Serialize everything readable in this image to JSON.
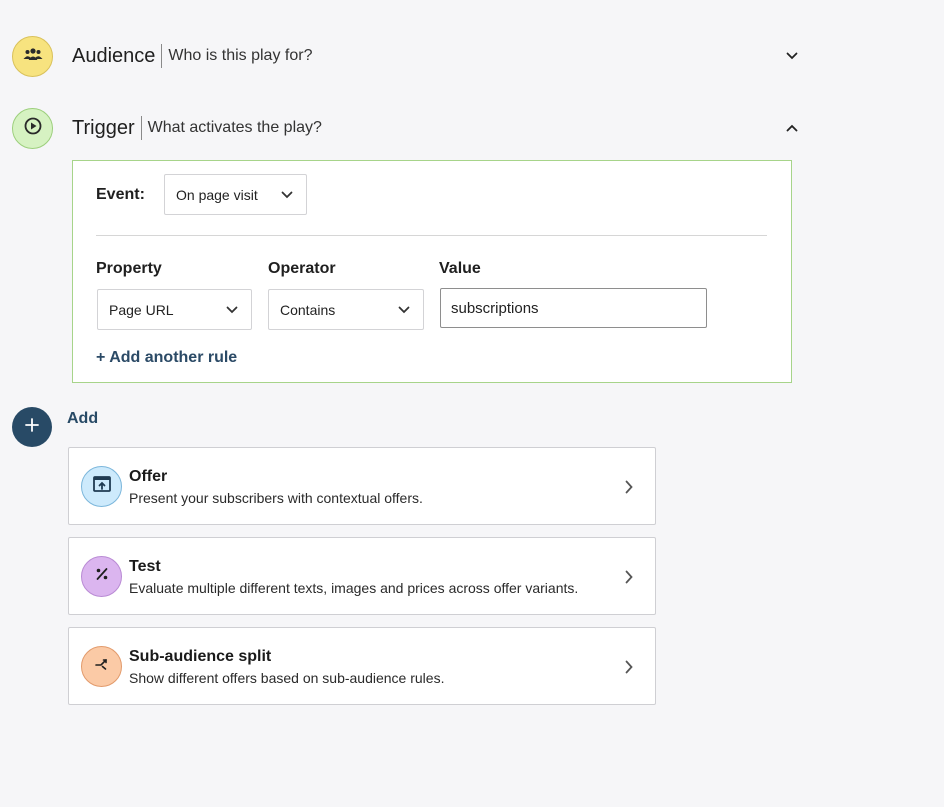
{
  "audience": {
    "title": "Audience",
    "subtitle": "Who is this play for?",
    "icon": "people-group-icon",
    "color": "#f7e37f"
  },
  "trigger": {
    "title": "Trigger",
    "subtitle": "What activates the play?",
    "icon": "play-circle-icon",
    "color": "#d6f2c2",
    "event_label": "Event:",
    "event_value": "On page visit",
    "property_label": "Property",
    "operator_label": "Operator",
    "value_label": "Value",
    "property_value": "Page URL",
    "operator_value": "Contains",
    "value_text": "subscriptions",
    "add_rule_label": "+ Add another rule"
  },
  "add": {
    "label": "Add",
    "color": "#284a66"
  },
  "cards": [
    {
      "title": "Offer",
      "description": "Present your subscribers with contextual offers.",
      "icon": "offer-window-icon",
      "color": "#cdeafc"
    },
    {
      "title": "Test",
      "description": "Evaluate multiple different texts, images and prices across offer variants.",
      "icon": "percent-icon",
      "color": "#dbb5ef"
    },
    {
      "title": "Sub-audience split",
      "description": "Show different offers based on sub-audience rules.",
      "icon": "split-arrows-icon",
      "color": "#fbcaa6"
    }
  ]
}
